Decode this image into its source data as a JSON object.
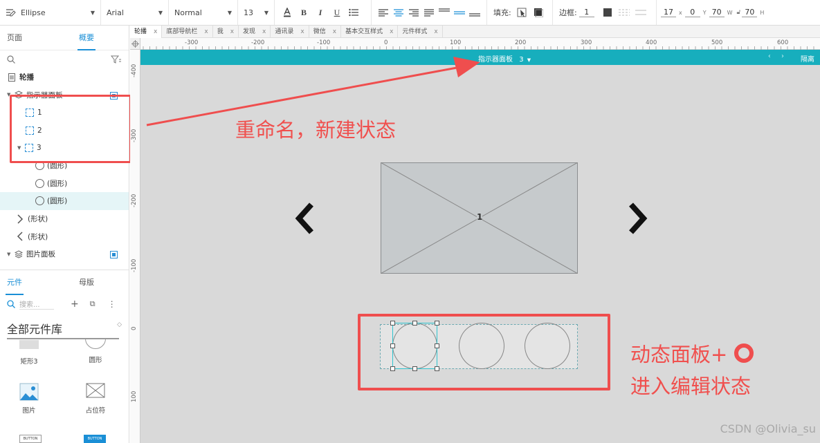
{
  "toolbar": {
    "widget_type": "Ellipse",
    "font_family": "Arial",
    "font_style": "Normal",
    "font_size": "13",
    "fill_label": "填充:",
    "border_label": "边框:",
    "border_value": "1",
    "x_value": "17",
    "x_label": "x",
    "y_value": "0",
    "y_label": "Y",
    "w_value": "70",
    "w_label": "W",
    "h_value": "70",
    "h_label": "H"
  },
  "left_panel": {
    "tabs": [
      "页面",
      "概要"
    ],
    "tree": [
      {
        "label": "轮播",
        "level": 0,
        "icon": "page-icon"
      },
      {
        "label": "指示器面板",
        "level": 1,
        "icon": "dynamic-panel-icon"
      },
      {
        "label": "1",
        "level": 2,
        "icon": "state-icon"
      },
      {
        "label": "2",
        "level": 2,
        "icon": "state-icon"
      },
      {
        "label": "3",
        "level": 2,
        "icon": "state-icon"
      },
      {
        "label": "(圆形)",
        "level": 3,
        "icon": "circle-icon"
      },
      {
        "label": "(圆形)",
        "level": 3,
        "icon": "circle-icon"
      },
      {
        "label": "(圆形)",
        "level": 3,
        "icon": "circle-icon"
      },
      {
        "label": "(形状)",
        "level": 1,
        "icon": "chevron-right-shape-icon"
      },
      {
        "label": "(形状)",
        "level": 1,
        "icon": "chevron-left-shape-icon"
      },
      {
        "label": "图片面板",
        "level": 1,
        "icon": "dynamic-panel-icon"
      }
    ],
    "lib_tabs": [
      "元件",
      "母版"
    ],
    "search_placeholder": "搜索...",
    "library_title": "全部元件库",
    "widgets": [
      {
        "label": "矩形3"
      },
      {
        "label": "圆形"
      },
      {
        "label": "图片"
      },
      {
        "label": "占位符"
      },
      {
        "label": "BUTTON"
      },
      {
        "label": "BUTTON"
      }
    ]
  },
  "doc_tabs": [
    {
      "label": "轮播",
      "active": true
    },
    {
      "label": "底部导航栏",
      "active": false
    },
    {
      "label": "我",
      "active": false
    },
    {
      "label": "发现",
      "active": false
    },
    {
      "label": "通讯录",
      "active": false
    },
    {
      "label": "微信",
      "active": false
    },
    {
      "label": "基本交互样式",
      "active": false
    },
    {
      "label": "元件样式",
      "active": false
    }
  ],
  "ruler": {
    "h_labels": [
      "-300",
      "-200",
      "-100",
      "0",
      "100",
      "200",
      "300",
      "400",
      "500",
      "600"
    ],
    "v_labels": [
      "-400",
      "-300",
      "-200",
      "-100",
      "0",
      "100"
    ]
  },
  "canvas": {
    "panel_bar_title": "指示器面板",
    "panel_bar_state": "3",
    "panel_bar_isolate": "隔离",
    "placeholder_label": "1"
  },
  "annotations": {
    "rename_note": "重命名，新建状态",
    "panel_note_line1": "动态面板+",
    "panel_note_line2": "进入编辑状态"
  },
  "watermark": "CSDN @Olivia_su"
}
